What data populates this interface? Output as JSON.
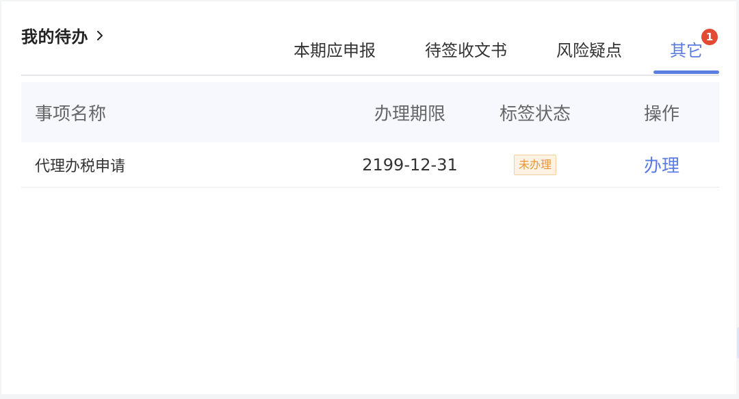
{
  "header": {
    "title": "我的待办",
    "chevron": "chevron-right-icon"
  },
  "tabs": [
    {
      "label": "本期应申报",
      "active": false
    },
    {
      "label": "待签收文书",
      "active": false
    },
    {
      "label": "风险疑点",
      "active": false
    },
    {
      "label": "其它",
      "active": true,
      "badge": "1"
    }
  ],
  "table": {
    "columns": [
      "事项名称",
      "办理期限",
      "标签状态",
      "操作"
    ],
    "rows": [
      {
        "name": "代理办税申请",
        "deadline": "2199-12-31",
        "status": "未办理",
        "action": "办理"
      }
    ]
  },
  "colors": {
    "accent": "#5b7ce0",
    "badge": "#e34a33",
    "status_text": "#e8953a",
    "status_bg": "#fdf2e3"
  }
}
